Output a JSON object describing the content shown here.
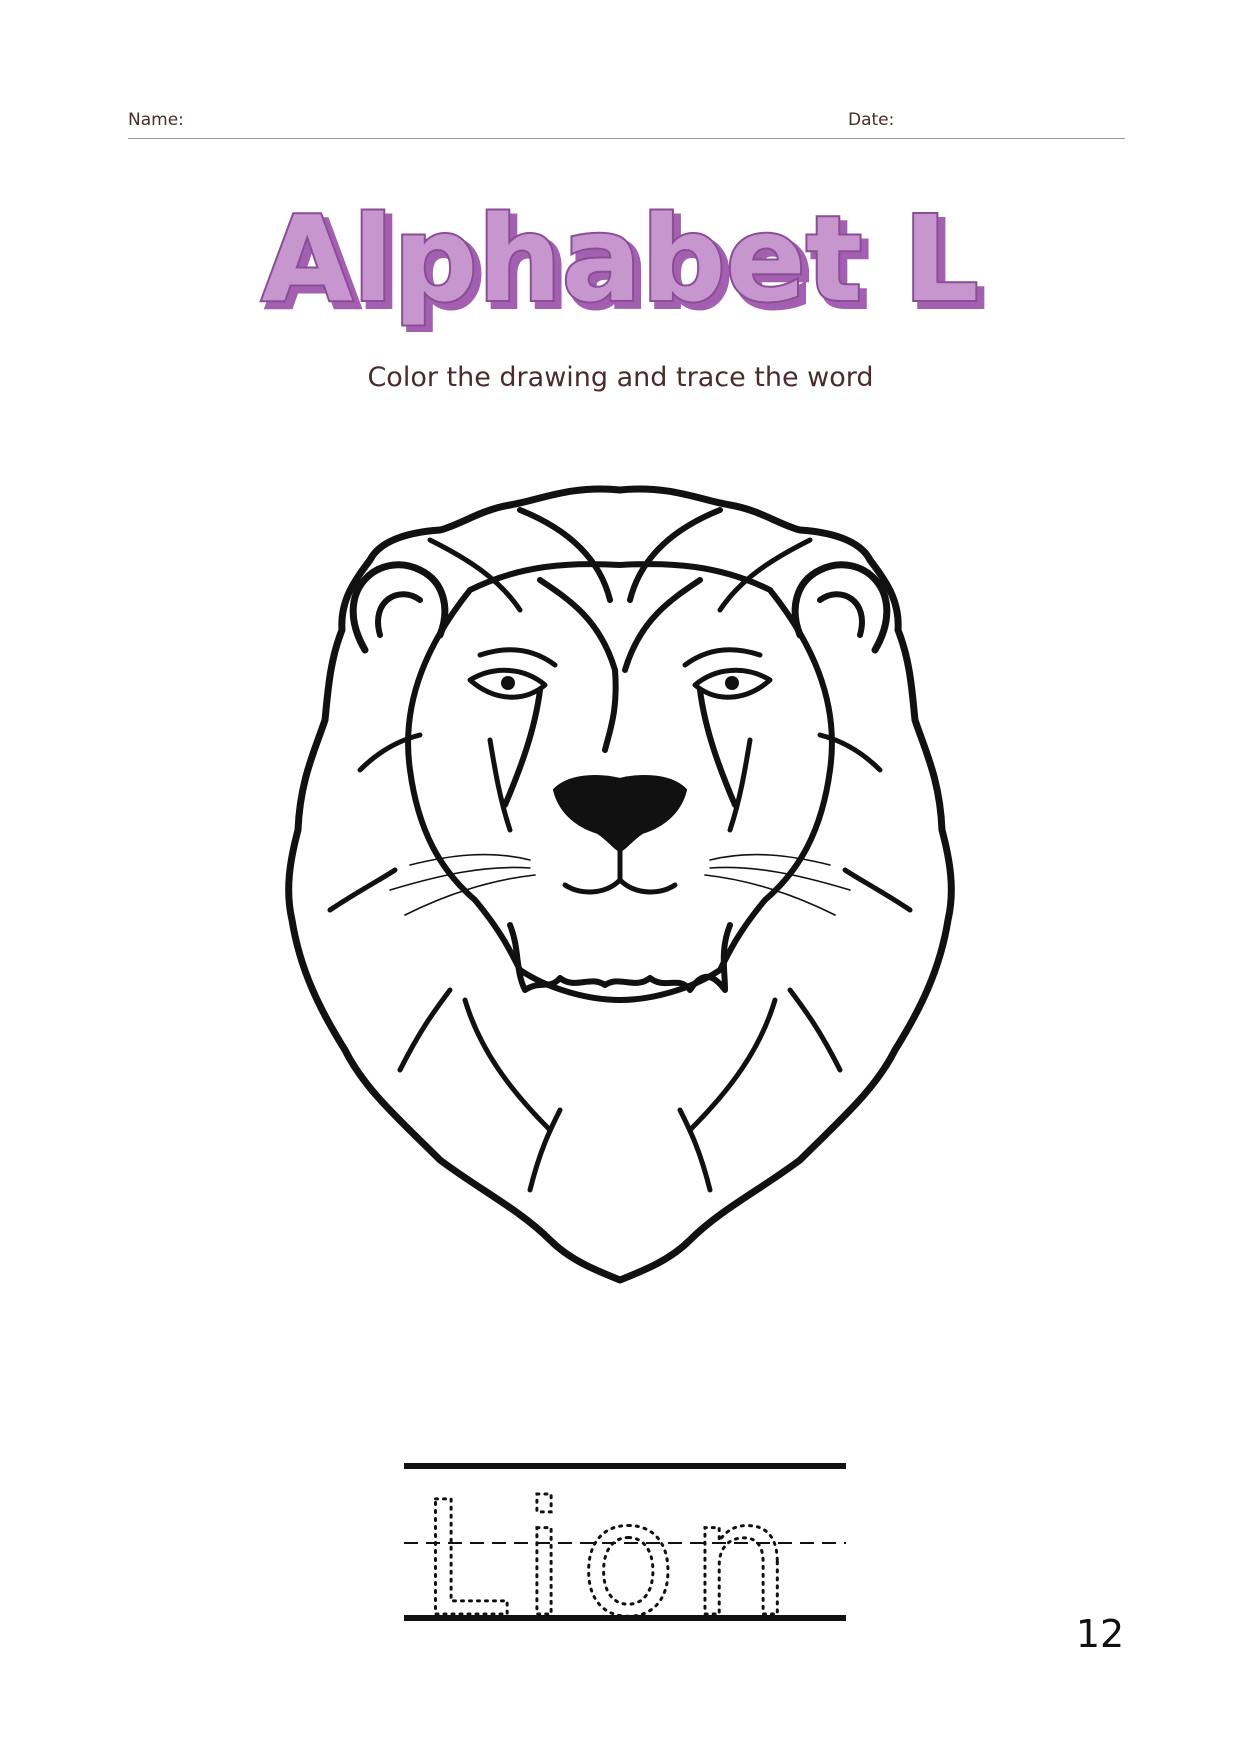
{
  "header": {
    "name_label": "Name:",
    "date_label": "Date:"
  },
  "title": "Alphabet L",
  "subtitle": "Color the drawing and trace the word",
  "trace_word": "Lion",
  "page_number": "12",
  "colors": {
    "title_fill": "#c896cf",
    "title_outline": "#8a4d96",
    "title_shadow": "#a35fb0",
    "text": "#4a2c2c",
    "ink": "#111111"
  },
  "illustration": "lion-head-line-art"
}
